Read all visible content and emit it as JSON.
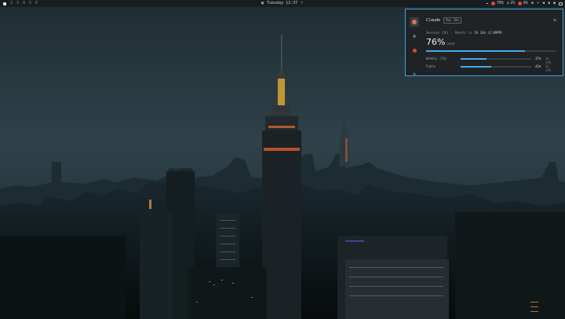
{
  "topbar": {
    "workspaces": [
      {
        "label": "1",
        "active": true
      },
      {
        "label": "2",
        "active": false
      },
      {
        "label": "3",
        "active": false
      },
      {
        "label": "4",
        "active": false
      },
      {
        "label": "5",
        "active": false
      },
      {
        "label": "6",
        "active": false
      }
    ],
    "clock_text": "Tuesday 12:37",
    "tray": {
      "mem": "78%",
      "cpu": "2%",
      "temp": "0%"
    }
  },
  "panel": {
    "title": "Claude",
    "plan_badge": "Max 20x",
    "session_label": "Session (5h)",
    "session_reset_label": "· Resets in",
    "session_reset_value": "2h 32m (2:09PM)",
    "big_percent": "76%",
    "big_percent_unit": "used",
    "big_percent_value": 0.76,
    "rows": [
      {
        "label": "Weekly (7d)",
        "percent": "37%",
        "value": 0.37,
        "reset": "3d 19h"
      },
      {
        "label": "Fable",
        "percent": "43%",
        "value": 0.43,
        "reset": "3d 19h"
      }
    ]
  },
  "colors": {
    "accent": "#3aa3e0",
    "bar_fill": "#4aa8e6",
    "claude_orange": "#d9754f"
  }
}
